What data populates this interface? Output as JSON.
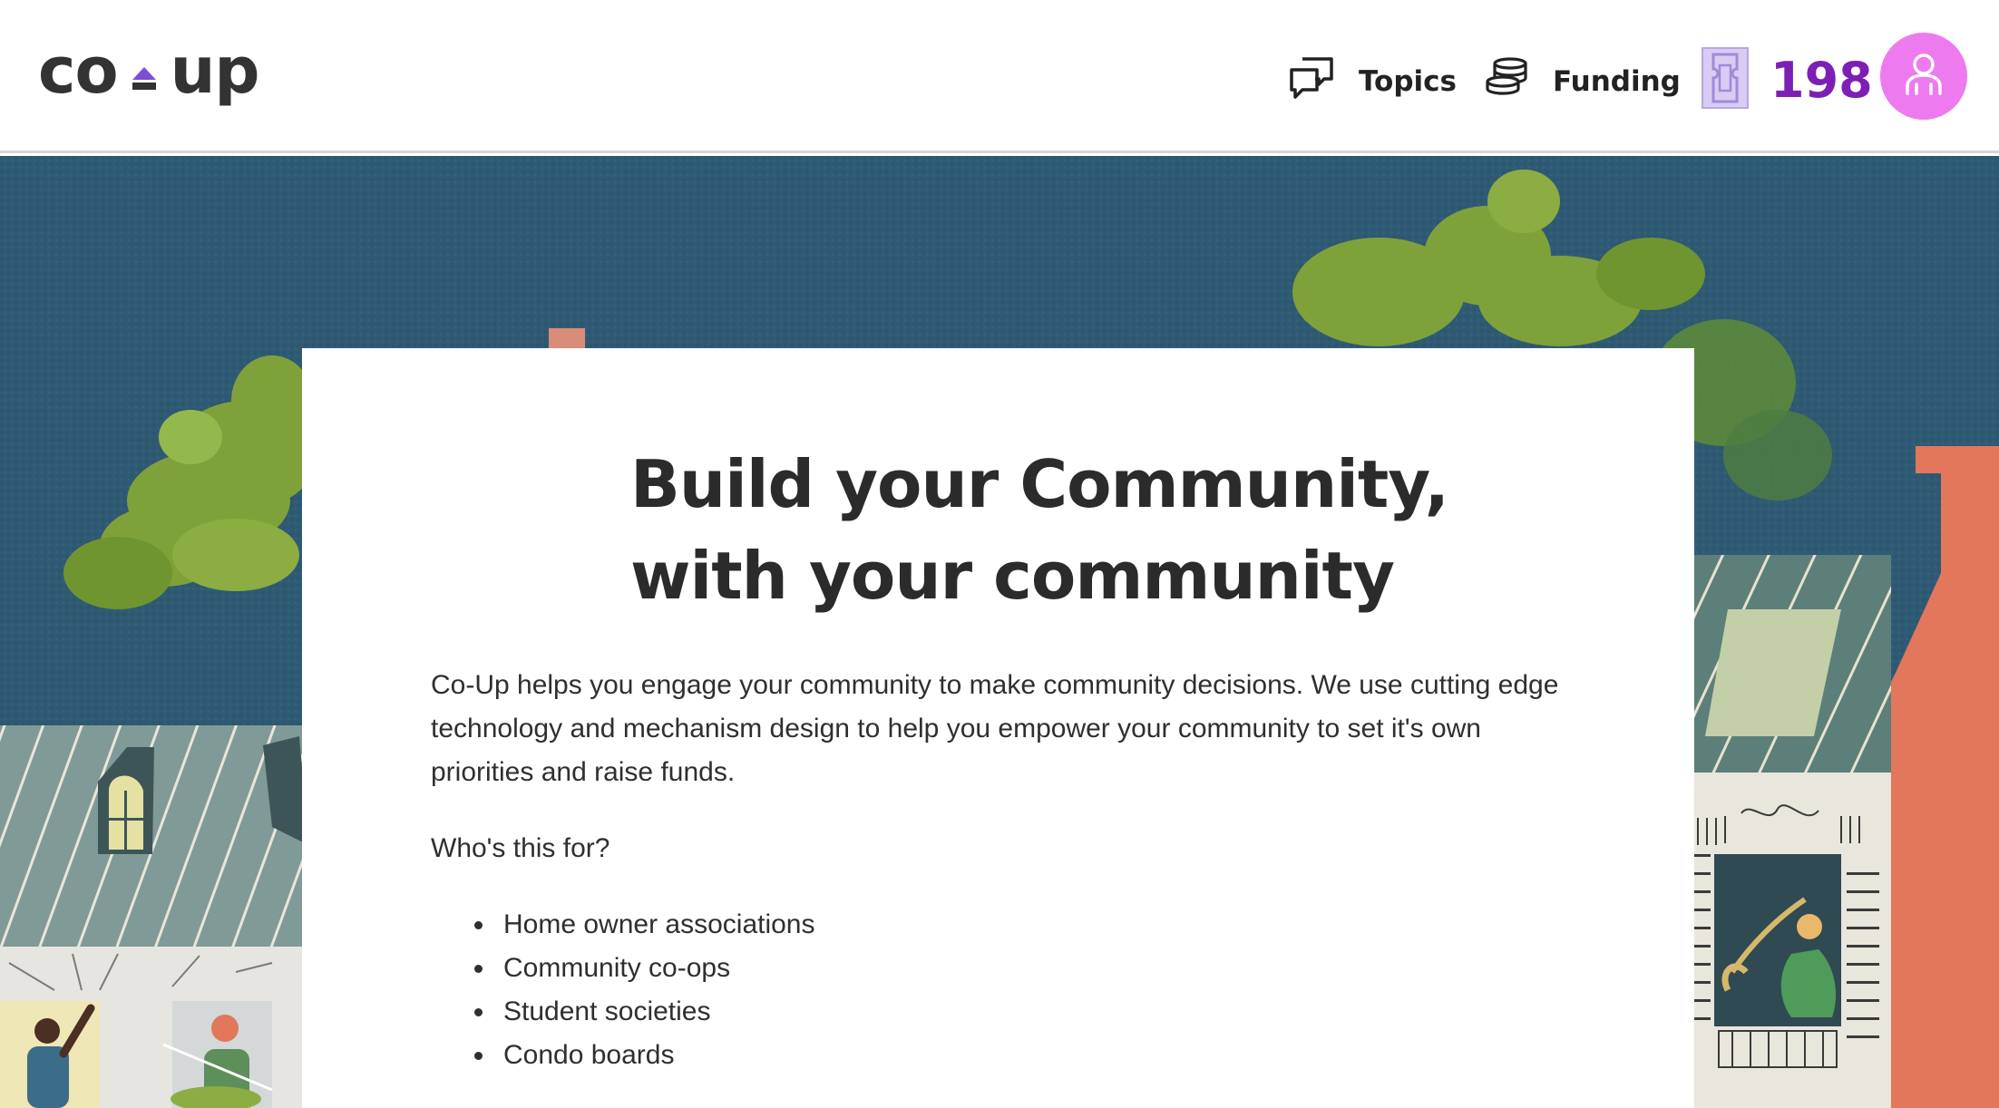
{
  "header": {
    "logo": {
      "left": "co",
      "right": "up"
    },
    "nav": [
      {
        "label": "Topics",
        "icon": "chat-bubbles-icon"
      },
      {
        "label": "Funding",
        "icon": "coin-stack-icon"
      }
    ],
    "tickets": {
      "icon": "ticket-icon",
      "count": "198"
    },
    "avatar_icon": "user-icon"
  },
  "hero": {
    "title_line1": "Build your Community,",
    "title_line2": "with your community",
    "intro": "Co-Up helps you engage your community to make community decisions. We use cutting edge technology and mechanism design to help you empower your community to set it's own priorities and raise funds.",
    "question": "Who's this for?",
    "audiences": [
      "Home owner associations",
      "Community co-ops",
      "Student societies",
      "Condo boards"
    ]
  },
  "colors": {
    "brand_purple": "#7d1fb4",
    "avatar_pink": "#ee7af0",
    "sky_blue": "#2f5a73",
    "foliage_green": "#7fa13a",
    "brick_orange": "#e2775c",
    "ticket_lavender": "#c9b8ec"
  }
}
